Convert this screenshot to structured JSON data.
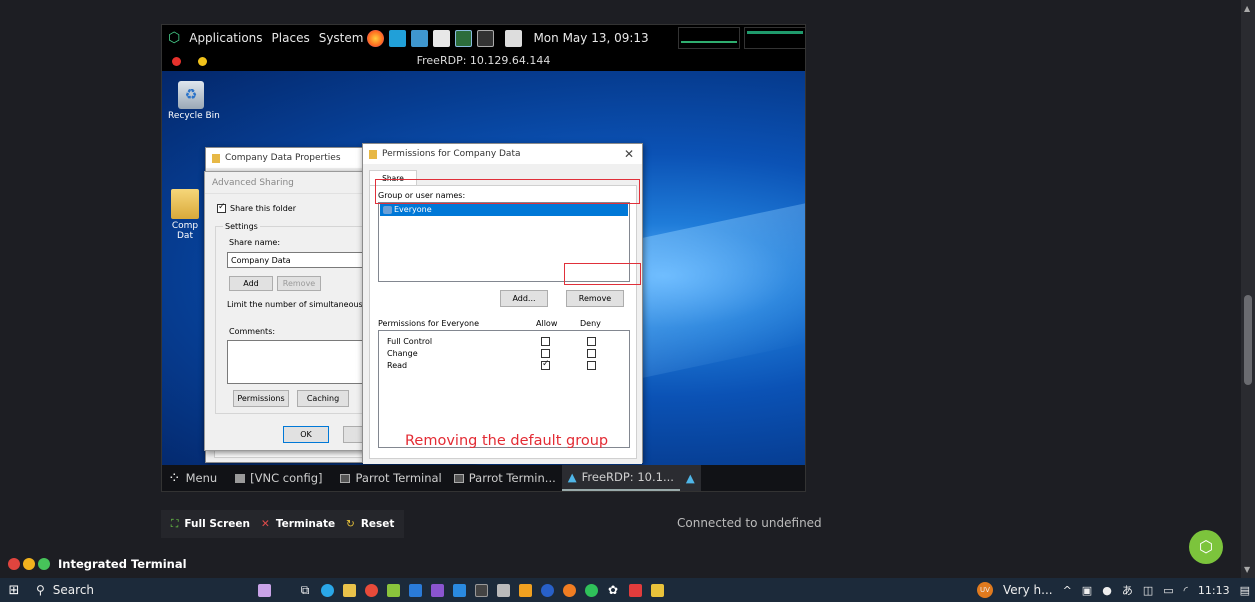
{
  "parrot_bar": {
    "menus": [
      "Applications",
      "Places",
      "System"
    ],
    "clock": "Mon May 13, 09:13"
  },
  "rdp": {
    "title": "FreeRDP: 10.129.64.144"
  },
  "desktop": {
    "recycle_label": "Recycle Bin",
    "folder_label_1": "Comp",
    "folder_label_2": "Dat"
  },
  "props_dialog": {
    "title": "Company Data Properties"
  },
  "advanced_sharing": {
    "header": "Advanced Sharing",
    "share_checkbox": "Share this folder",
    "settings_label": "Settings",
    "share_name_label": "Share name:",
    "share_name_value": "Company Data",
    "add_button": "Add",
    "remove_button": "Remove",
    "limit_label": "Limit the number of simultaneous us",
    "comments_label": "Comments:",
    "permissions_button": "Permissions",
    "caching_button": "Caching",
    "ok_button": "OK"
  },
  "permissions_dialog": {
    "title": "Permissions for Company Data",
    "tab": "Share Permissions",
    "group_label": "Group or user names:",
    "groups": [
      "Everyone"
    ],
    "add_button": "Add...",
    "remove_button": "Remove",
    "perm_header": "Permissions for Everyone",
    "allow_header": "Allow",
    "deny_header": "Deny",
    "permissions": [
      {
        "name": "Full Control",
        "allow": false,
        "deny": false
      },
      {
        "name": "Change",
        "allow": false,
        "deny": false
      },
      {
        "name": "Read",
        "allow": true,
        "deny": false
      }
    ]
  },
  "annotation": "Removing the default group",
  "parrot_taskbar": {
    "menu": "Menu",
    "items": [
      "[VNC config]",
      "Parrot Terminal",
      "Parrot Termin...",
      "FreeRDP: 10.1..."
    ]
  },
  "controls": {
    "fullscreen": "Full Screen",
    "terminate": "Terminate",
    "reset": "Reset",
    "status": "Connected to undefined"
  },
  "terminal": {
    "label": "Integrated Terminal"
  },
  "windows_taskbar": {
    "search": "Search",
    "notification_text": "Very h...",
    "time": "11:13",
    "avatar": "UV"
  }
}
